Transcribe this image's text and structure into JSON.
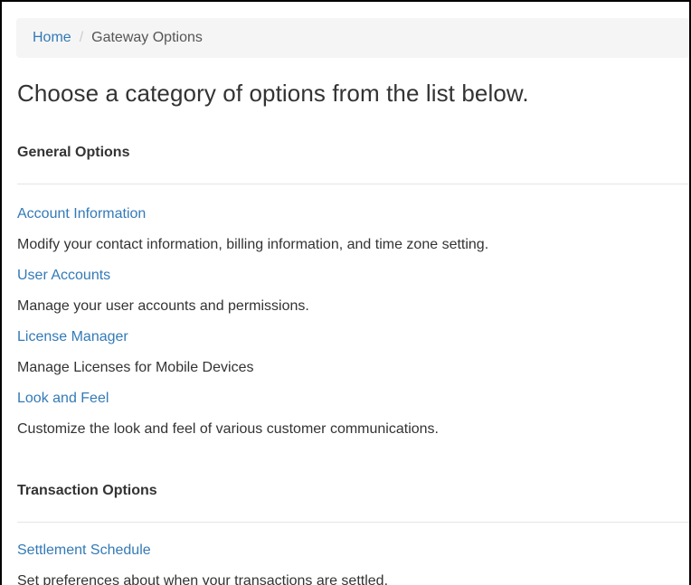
{
  "breadcrumb": {
    "home": "Home",
    "separator": "/",
    "current": "Gateway Options"
  },
  "page": {
    "title": "Choose a category of options from the list below."
  },
  "sections": [
    {
      "title": "General Options",
      "items": [
        {
          "label": "Account Information",
          "description": "Modify your contact information, billing information, and time zone setting."
        },
        {
          "label": "User Accounts",
          "description": "Manage your user accounts and permissions."
        },
        {
          "label": "License Manager",
          "description": "Manage Licenses for Mobile Devices"
        },
        {
          "label": "Look and Feel",
          "description": "Customize the look and feel of various customer communications."
        }
      ]
    },
    {
      "title": "Transaction Options",
      "items": [
        {
          "label": "Settlement Schedule",
          "description": "Set preferences about when your transactions are settled."
        }
      ]
    }
  ],
  "colors": {
    "link": "#337ab7",
    "text": "#333333",
    "breadcrumb_bg": "#f5f5f5",
    "divider": "#e5e5e5"
  }
}
